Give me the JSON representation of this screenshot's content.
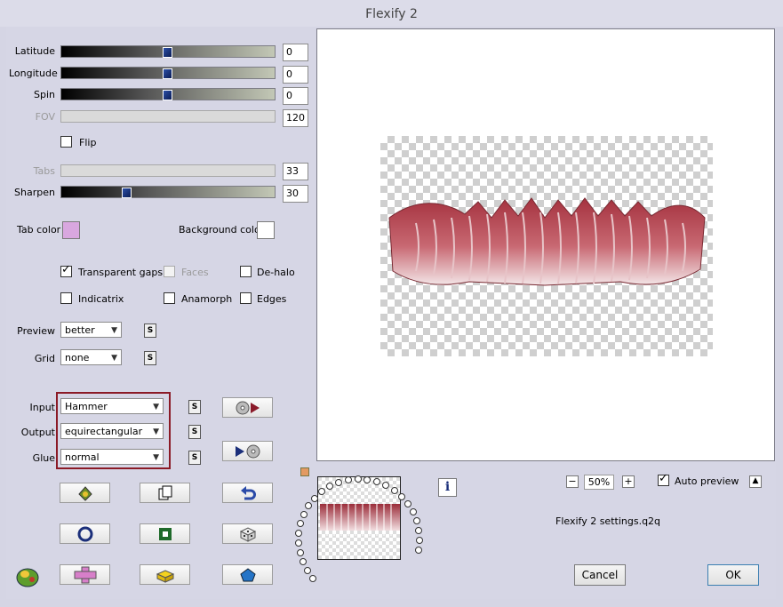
{
  "window": {
    "title": "Flexify 2"
  },
  "sliders": [
    {
      "label": "Latitude",
      "value": "0",
      "enabled": true,
      "position": 0.5
    },
    {
      "label": "Longitude",
      "value": "0",
      "enabled": true,
      "position": 0.5
    },
    {
      "label": "Spin",
      "value": "0",
      "enabled": true,
      "position": 0.5
    },
    {
      "label": "FOV",
      "value": "120",
      "enabled": false
    },
    {
      "label": "Tabs",
      "value": "33",
      "enabled": false
    },
    {
      "label": "Sharpen",
      "value": "30",
      "enabled": true,
      "position": 0.3
    }
  ],
  "flip": {
    "label": "Flip",
    "checked": false
  },
  "tab_color": {
    "label": "Tab color",
    "color": "#d9a7df"
  },
  "background_color": {
    "label": "Background color",
    "color": "#ffffff"
  },
  "options": {
    "transparent_gaps": {
      "label": "Transparent gaps",
      "checked": true
    },
    "faces": {
      "label": "Faces",
      "checked": false,
      "enabled": false
    },
    "de_halo": {
      "label": "De-halo",
      "checked": false
    },
    "indicatrix": {
      "label": "Indicatrix",
      "checked": false
    },
    "anamorph": {
      "label": "Anamorph",
      "checked": false
    },
    "edges": {
      "label": "Edges",
      "checked": false
    }
  },
  "preview_select": {
    "label": "Preview",
    "value": "better"
  },
  "grid_select": {
    "label": "Grid",
    "value": "none"
  },
  "input_select": {
    "label": "Input",
    "value": "Hammer"
  },
  "output_select": {
    "label": "Output",
    "value": "equirectangular"
  },
  "glue_select": {
    "label": "Glue",
    "value": "normal"
  },
  "s_button": "S",
  "zoom": {
    "minus": "−",
    "value": "50%",
    "plus": "+"
  },
  "auto_preview": {
    "label": "Auto preview",
    "checked": true
  },
  "settings_file": "Flexify 2 settings.q2q",
  "info_icon": "i",
  "buttons": {
    "cancel": "Cancel",
    "ok": "OK"
  },
  "icons": [
    "apply-icon",
    "copy-icon",
    "undo-icon",
    "ring-icon",
    "square-icon",
    "dice-icon",
    "cross-icon",
    "block-icon",
    "pentagon-icon",
    "disc-play-icon",
    "play-disc-icon",
    "logo-icon"
  ],
  "colors": {
    "accent_red": "#8b1a26",
    "window_bg": "#d6d6e5",
    "ok_border": "#3c7fb1"
  }
}
